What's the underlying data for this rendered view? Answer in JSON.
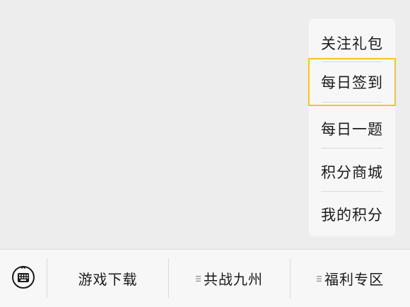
{
  "popup_menu": {
    "items": [
      {
        "label": "关注礼包"
      },
      {
        "label": "每日签到"
      },
      {
        "label": "每日一题"
      },
      {
        "label": "积分商城"
      },
      {
        "label": "我的积分"
      }
    ]
  },
  "bottom_bar": {
    "keyboard_icon": "keyboard-icon",
    "menu_icon": "menu-lines-icon",
    "tabs": [
      {
        "label": "游戏下载"
      },
      {
        "label": "共战九州"
      },
      {
        "label": "福利专区"
      }
    ]
  },
  "colors": {
    "highlight_border": "#f5c22b",
    "background": "#ededed",
    "panel": "#f7f7f7"
  }
}
